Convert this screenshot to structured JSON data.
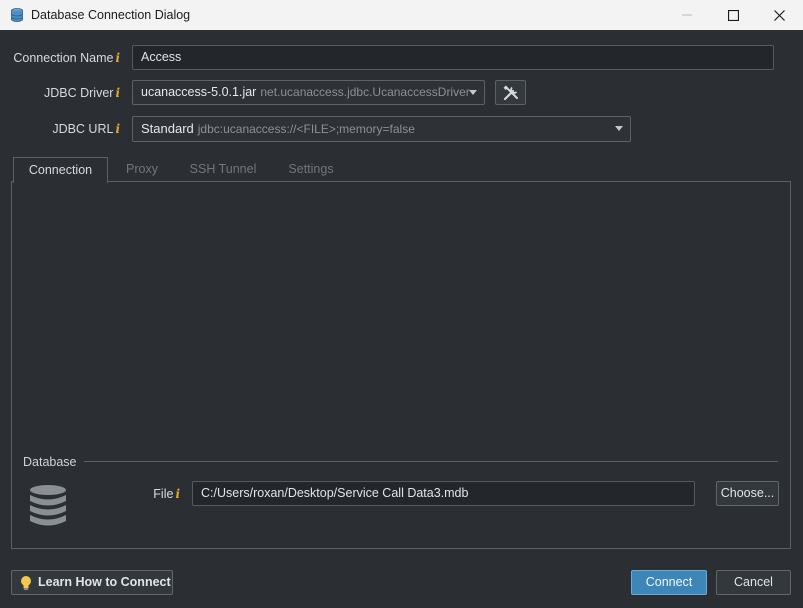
{
  "window": {
    "title": "Database Connection Dialog"
  },
  "form": {
    "connection_name": {
      "label": "Connection Name",
      "value": "Access"
    },
    "jdbc_driver": {
      "label": "JDBC Driver",
      "value": "ucanaccess-5.0.1.jar",
      "detail": "net.ucanaccess.jdbc.UcanaccessDriver"
    },
    "jdbc_url": {
      "label": "JDBC URL",
      "value": "Standard",
      "detail": "jdbc:ucanaccess://<FILE>;memory=false"
    },
    "info_mark": "i"
  },
  "tabs": [
    {
      "label": "Connection",
      "active": true
    },
    {
      "label": "Proxy",
      "active": false
    },
    {
      "label": "SSH Tunnel",
      "active": false
    },
    {
      "label": "Settings",
      "active": false
    }
  ],
  "database": {
    "section_label": "Database",
    "file_label": "File",
    "file_value": "C:/Users/roxan/Desktop/Service Call Data3.mdb",
    "choose_label": "Choose..."
  },
  "footer": {
    "learn_label": "Learn How to Connect",
    "connect_label": "Connect",
    "cancel_label": "Cancel"
  },
  "colors": {
    "accent": "#3d86b8",
    "info": "#e0a82e",
    "background": "#2b2f33"
  }
}
